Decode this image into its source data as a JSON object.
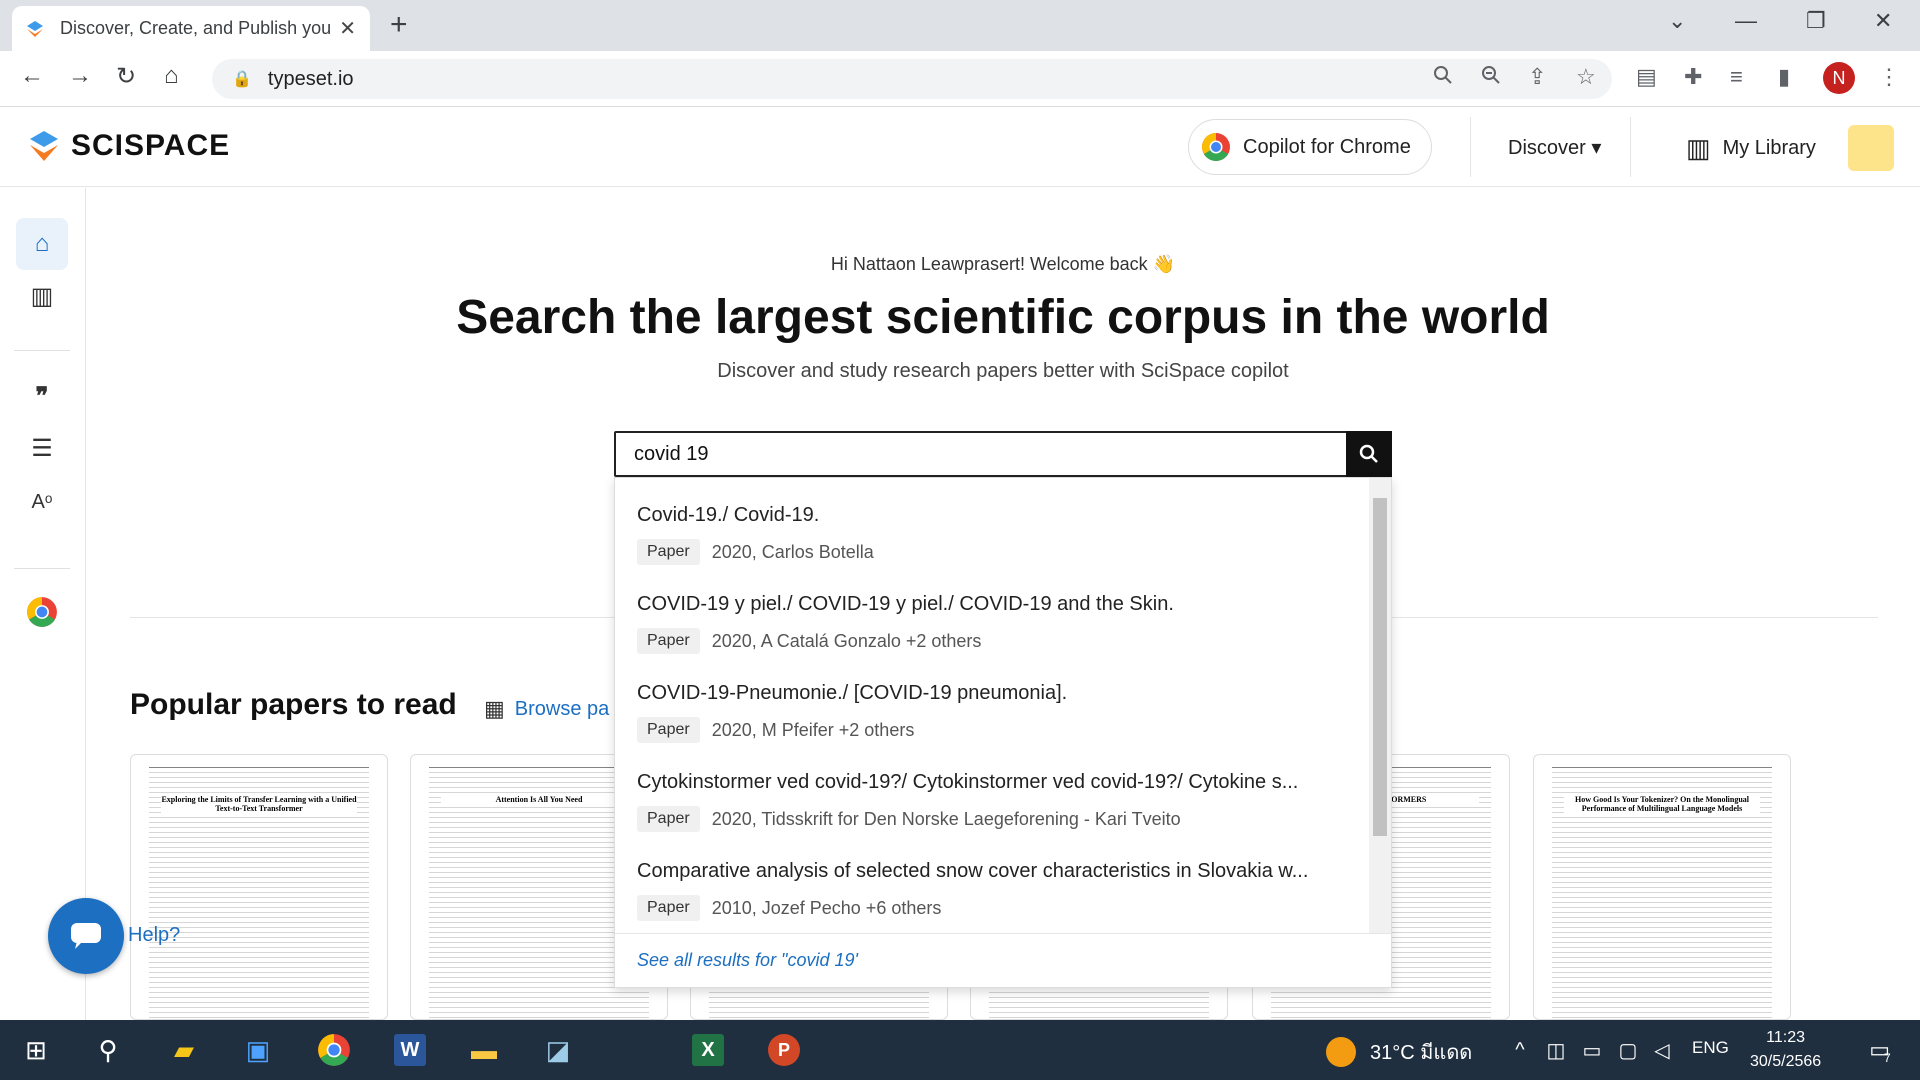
{
  "browser": {
    "tab_title": "Discover, Create, and Publish your",
    "url": "typeset.io"
  },
  "site": {
    "logo_text": "SCISPACE",
    "copilot_label": "Copilot for Chrome",
    "discover_label": "Discover ▾",
    "library_label": "My Library"
  },
  "main": {
    "welcome": "Hi Nattaon Leawprasert! Welcome back 👋",
    "headline": "Search the largest scientific corpus in the world",
    "subline": "Discover and study research papers better with SciSpace copilot",
    "search_value": "covid 19",
    "popular_title": "Popular papers to read",
    "browse_label": "Browse pa",
    "help_label": "Help?"
  },
  "suggestions": [
    {
      "title": "Covid-19./ Covid-19.",
      "badge": "Paper",
      "info": "2020, Carlos Botella"
    },
    {
      "title": "COVID-19 y piel./ COVID-19 y piel./ COVID-19 and the Skin.",
      "badge": "Paper",
      "info": "2020, A Catalá Gonzalo +2 others"
    },
    {
      "title": "COVID-19-Pneumonie./ [COVID-19 pneumonia].",
      "badge": "Paper",
      "info": "2020, M Pfeifer +2 others"
    },
    {
      "title": "Cytokinstormer ved covid-19?/ Cytokinstormer ved covid-19?/ Cytokine s...",
      "badge": "Paper",
      "info": "2020, Tidsskrift for Den Norske Laegeforening - Kari Tveito"
    },
    {
      "title": "Comparative analysis of selected snow cover characteristics in Slovakia w...",
      "badge": "Paper",
      "info": "2010, Jozef Pecho +6 others"
    }
  ],
  "see_all": "See all results for \"covid 19'",
  "cards": [
    {
      "title": "Exploring the Limits of Transfer Learning with a Unified Text-to-Text Transformer"
    },
    {
      "title": "Attention Is All You Need"
    },
    {
      "title": ""
    },
    {
      "title": ""
    },
    {
      "title": "ABLE TRANSFORMERS"
    },
    {
      "title": "How Good Is Your Tokenizer? On the Monolingual Performance of Multilingual Language Models"
    }
  ],
  "taskbar": {
    "weather": "31°C มีแดด",
    "lang": "ENG",
    "time": "11:23",
    "date": "30/5/2566",
    "notif_count": "7"
  },
  "colors": {
    "accent": "#1c6fc1",
    "taskbar": "#1f2f3f"
  }
}
